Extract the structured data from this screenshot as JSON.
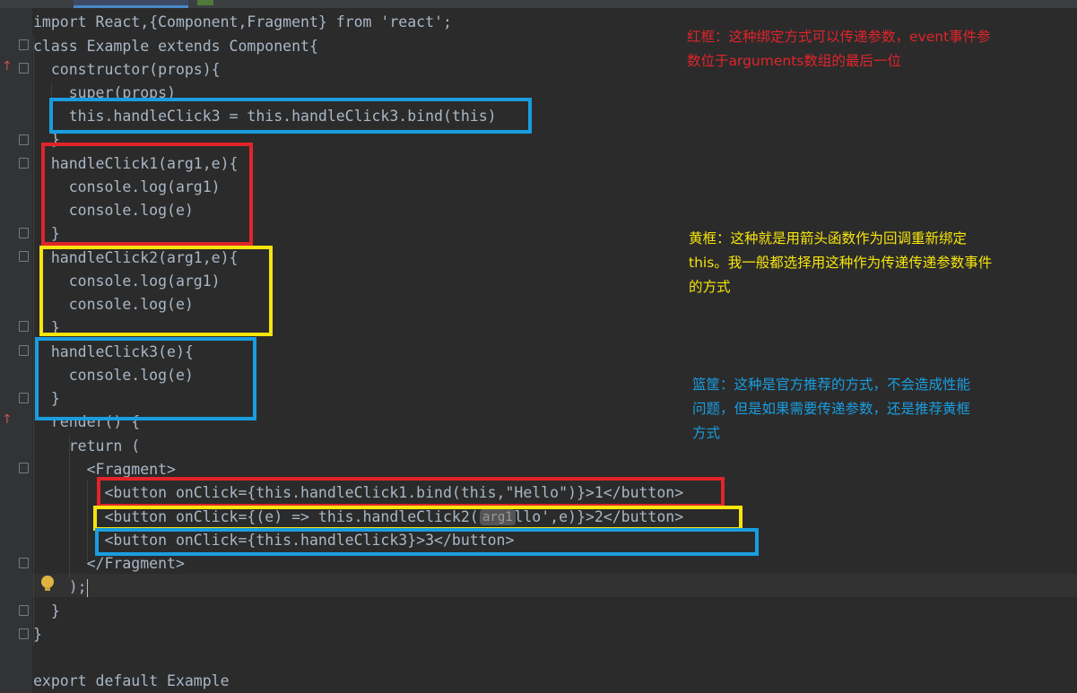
{
  "code_lines": [
    "import React,{Component,Fragment} from 'react';",
    "class Example extends Component{",
    "  constructor(props){",
    "    super(props)",
    "    this.handleClick3 = this.handleClick3.bind(this)",
    "  }",
    "  handleClick1(arg1,e){",
    "    console.log(arg1)",
    "    console.log(e)",
    "  }",
    "  handleClick2(arg1,e){",
    "    console.log(arg1)",
    "    console.log(e)",
    "  }",
    "  handleClick3(e){",
    "    console.log(e)",
    "  }",
    "  render() {",
    "    return (",
    "      <Fragment>",
    "        <button onClick={this.handleClick1.bind(this,\"Hello\")}>1</button>",
    "        <button onClick={(e) => this.handleClick2( 'Hello',e)}>2</button>",
    "        <button onClick={this.handleClick3}>3</button>",
    "      </Fragment>",
    "    );",
    "  }",
    "}",
    "",
    "export default Example"
  ],
  "inlay_hint": "arg1",
  "notes": {
    "red": "红框：这种绑定方式可以传递参数，event事件参\n数位于arguments数组的最后一位",
    "yellow": "黄框：这种就是用箭头函数作为回调重新绑定\nthis。我一般都选择用这种作为传递传递参数事件\n的方式",
    "blue": "篮筐：这种是官方推荐的方式，不会造成性能\n问题，但是如果需要传递参数，还是推荐黄框\n方式"
  },
  "colors": {
    "background": "#2b2b2b",
    "red": "#e1242a",
    "yellow": "#f6e40c",
    "blue": "#1a9de0"
  }
}
